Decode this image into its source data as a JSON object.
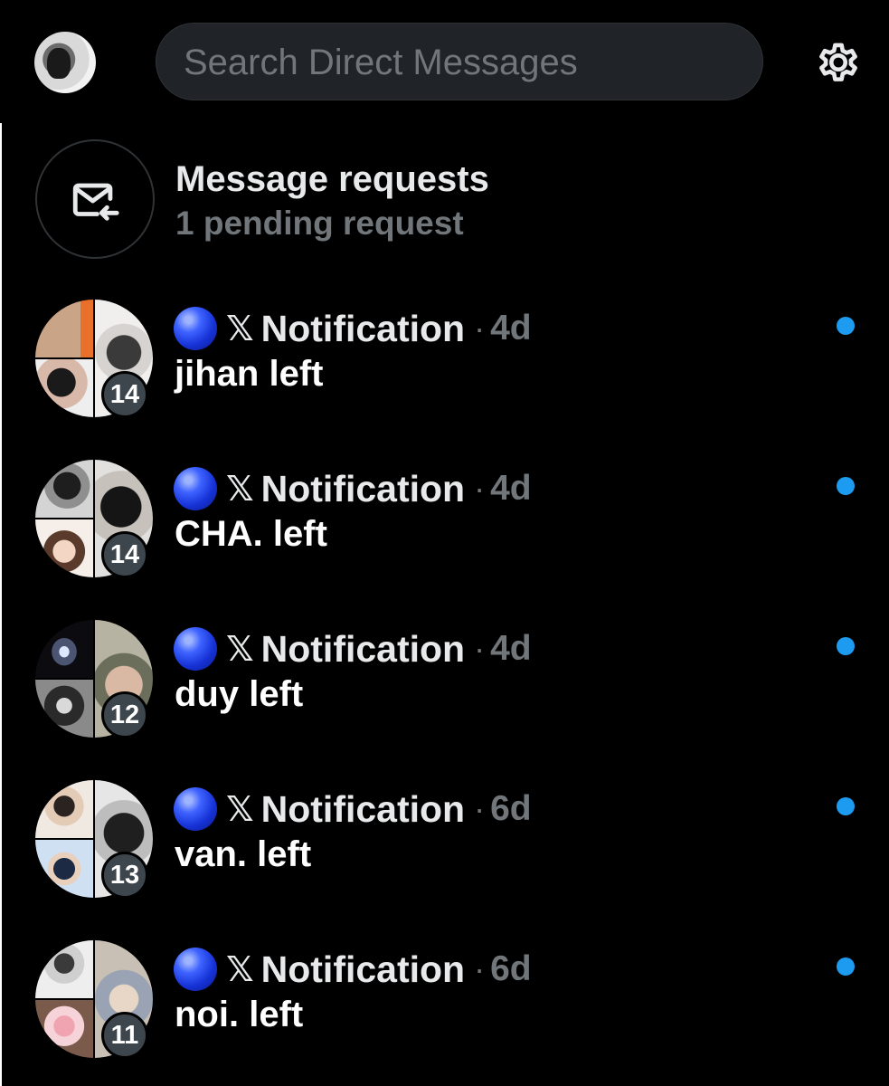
{
  "header": {
    "search_placeholder": "Search Direct Messages",
    "avatar_icon": "user-avatar",
    "settings_icon": "gear-icon"
  },
  "requests": {
    "title": "Message requests",
    "subtitle": "1 pending request",
    "icon": "mail-incoming-icon"
  },
  "conversations": [
    {
      "name": "Notification",
      "time": "4d",
      "preview": "jihan left",
      "count": "14",
      "unread": true
    },
    {
      "name": "Notification",
      "time": "4d",
      "preview": "CHA. left",
      "count": "14",
      "unread": true
    },
    {
      "name": "Notification",
      "time": "4d",
      "preview": "duy left",
      "count": "12",
      "unread": true
    },
    {
      "name": "Notification",
      "time": "6d",
      "preview": "van. left",
      "count": "13",
      "unread": true
    },
    {
      "name": "Notification",
      "time": "6d",
      "preview": "noi. left",
      "count": "11",
      "unread": true
    }
  ],
  "glyphs": {
    "x_logo": "𝕏",
    "separator": "·"
  },
  "colors": {
    "background": "#000000",
    "accent": "#1d9bf0",
    "muted": "#71767b",
    "badge": "#3d454d"
  }
}
